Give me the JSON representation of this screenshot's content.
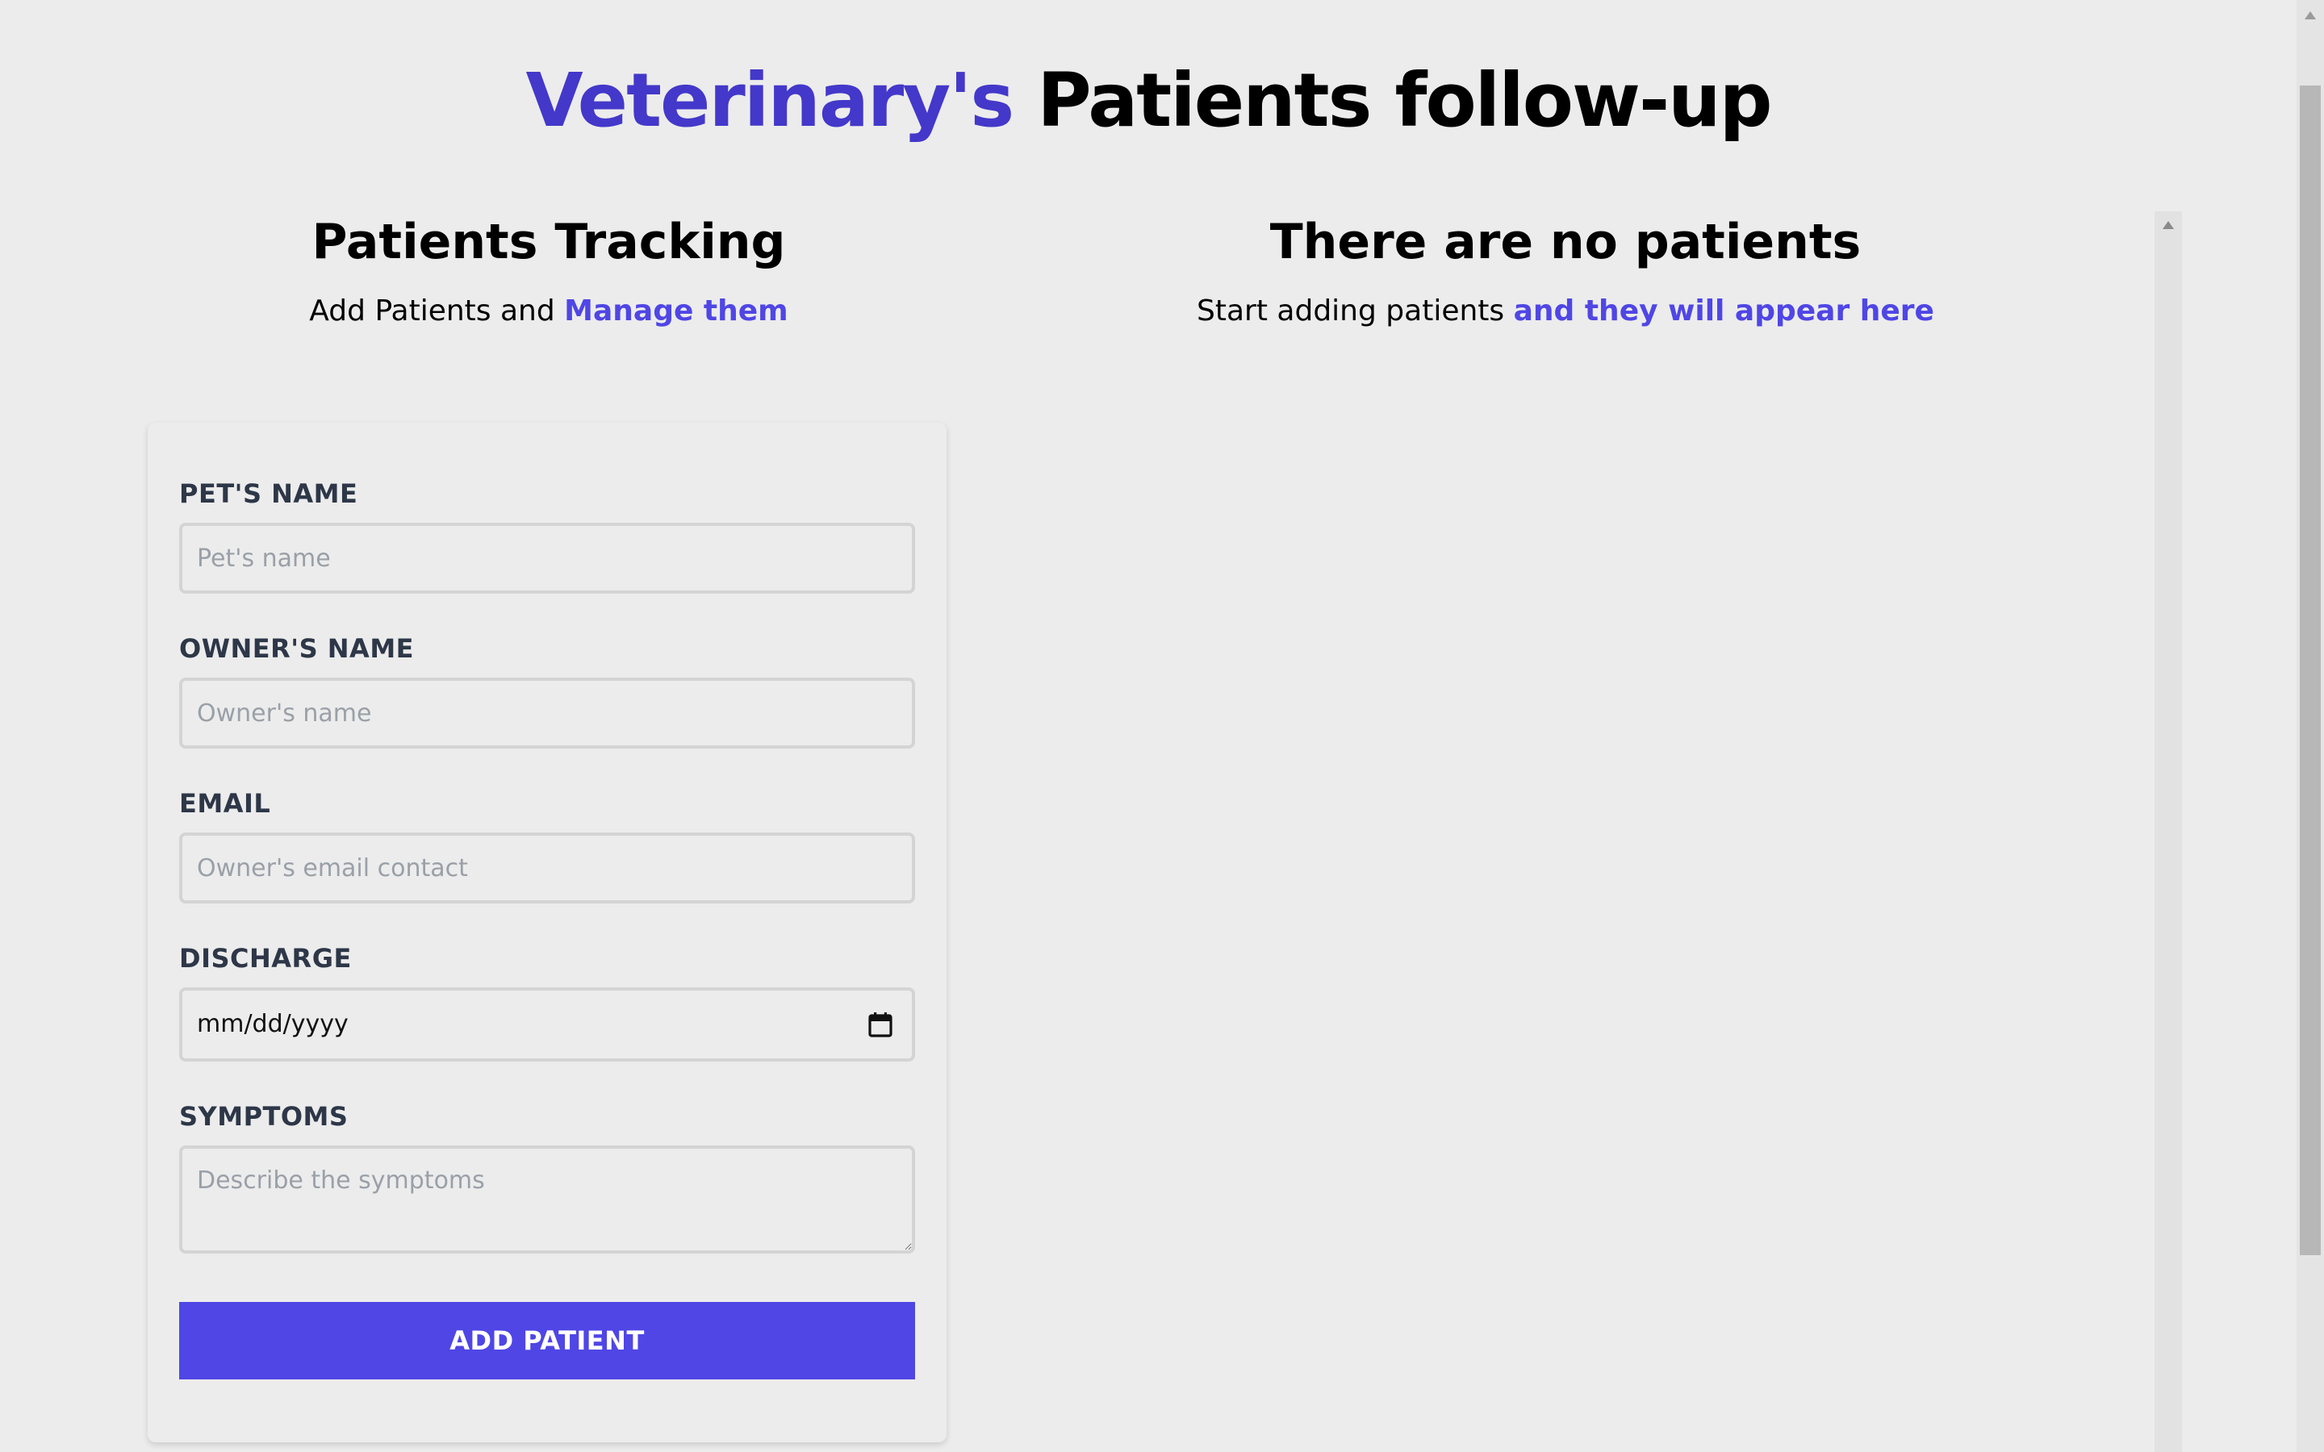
{
  "header": {
    "title_accent": "Veterinary's",
    "title_rest": "Patients follow-up"
  },
  "tracking": {
    "title": "Patients Tracking",
    "subtitle_plain": "Add Patients and",
    "subtitle_highlight": "Manage them"
  },
  "patients_panel": {
    "title": "There are no patients",
    "subtitle_plain": "Start adding patients",
    "subtitle_highlight": "and they will appear here"
  },
  "form": {
    "pet_name": {
      "label": "PET'S NAME",
      "placeholder": "Pet's name",
      "value": ""
    },
    "owner_name": {
      "label": "OWNER'S NAME",
      "placeholder": "Owner's name",
      "value": ""
    },
    "email": {
      "label": "EMAIL",
      "placeholder": "Owner's email contact",
      "value": ""
    },
    "discharge": {
      "label": "DISCHARGE",
      "placeholder": "mm/dd/yyyy",
      "value": ""
    },
    "symptoms": {
      "label": "SYMPTOMS",
      "placeholder": "Describe the symptoms",
      "value": ""
    },
    "submit_label": "ADD PATIENT"
  },
  "colors": {
    "accent": "#4338ca",
    "button": "#4f46e5",
    "background": "#ececec",
    "label": "#2d3748"
  },
  "icons": {
    "date_picker": "calendar-icon",
    "scroll_up": "arrow-up-icon"
  }
}
